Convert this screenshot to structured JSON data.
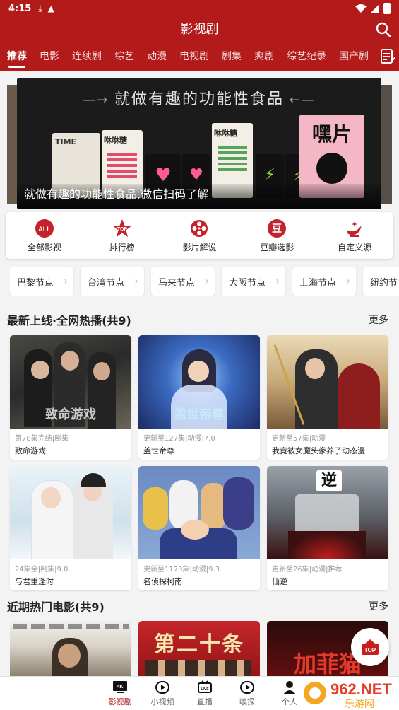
{
  "status": {
    "time": "4:15"
  },
  "header": {
    "title": "影视剧"
  },
  "tabs": [
    {
      "label": "推荐",
      "active": true
    },
    {
      "label": "电影"
    },
    {
      "label": "连续剧"
    },
    {
      "label": "综艺"
    },
    {
      "label": "动漫"
    },
    {
      "label": "电视剧"
    },
    {
      "label": "剧集"
    },
    {
      "label": "爽剧"
    },
    {
      "label": "综艺纪录"
    },
    {
      "label": "国产剧"
    },
    {
      "label": "E"
    }
  ],
  "banner": {
    "slogan": "就做有趣的功能性食品",
    "caption": "就做有趣的功能性食品,微信扫码了解",
    "product_texts": [
      "TIME",
      "咻咻糖",
      "咻咻糖",
      "嘿片"
    ]
  },
  "quick_menu": [
    {
      "label": "全部影视",
      "icon": "all-icon"
    },
    {
      "label": "排行榜",
      "icon": "top-star-icon"
    },
    {
      "label": "影片解说",
      "icon": "film-reel-icon"
    },
    {
      "label": "豆瓣选影",
      "icon": "douban-icon"
    },
    {
      "label": "自定义源",
      "icon": "magic-lamp-icon"
    }
  ],
  "quick_icon_text": {
    "all": "ALL",
    "top": "TOP",
    "douban": "豆"
  },
  "nodes": [
    "巴黎节点",
    "台湾节点",
    "马来节点",
    "大阪节点",
    "上海节点",
    "纽约节"
  ],
  "section1": {
    "title": "最新上线·全网热播(共9)",
    "more": "更多",
    "items": [
      {
        "meta": "第78集完结|剧集",
        "name": "致命游戏",
        "poster_text": "致命游戏"
      },
      {
        "meta": "更新至127集|动漫|7.0",
        "name": "盖世帝尊",
        "poster_text": "盖世帝尊"
      },
      {
        "meta": "更新至57集|动漫",
        "name": "我竟被女魔头豢养了动态漫",
        "poster_text": ""
      },
      {
        "meta": "24集全|剧集|9.0",
        "name": "与君重逢时",
        "poster_text": ""
      },
      {
        "meta": "更新至1173集|动漫|9.3",
        "name": "名侦探柯南",
        "poster_text": ""
      },
      {
        "meta": "更新至26集|动漫|推荐",
        "name": "仙逆",
        "poster_text": "逆"
      }
    ]
  },
  "section2": {
    "title": "近期热门电影(共9)",
    "more": "更多",
    "poster_texts": [
      "",
      "第二十条",
      "加菲猫"
    ]
  },
  "fab": {
    "label": "TOP"
  },
  "bottom_nav": [
    {
      "label": "影视剧",
      "active": true,
      "icon": "tv-4k-icon"
    },
    {
      "label": "小视频",
      "icon": "play-circle-icon"
    },
    {
      "label": "直播",
      "icon": "live-tv-icon"
    },
    {
      "label": "嗅探",
      "icon": "play-circle-icon"
    },
    {
      "label": "个人",
      "icon": "person-icon"
    }
  ],
  "watermark": {
    "text": "962.NET",
    "sub": "乐游网"
  },
  "colors": {
    "brand": "#b31b1b",
    "background": "#f3f3f3"
  }
}
